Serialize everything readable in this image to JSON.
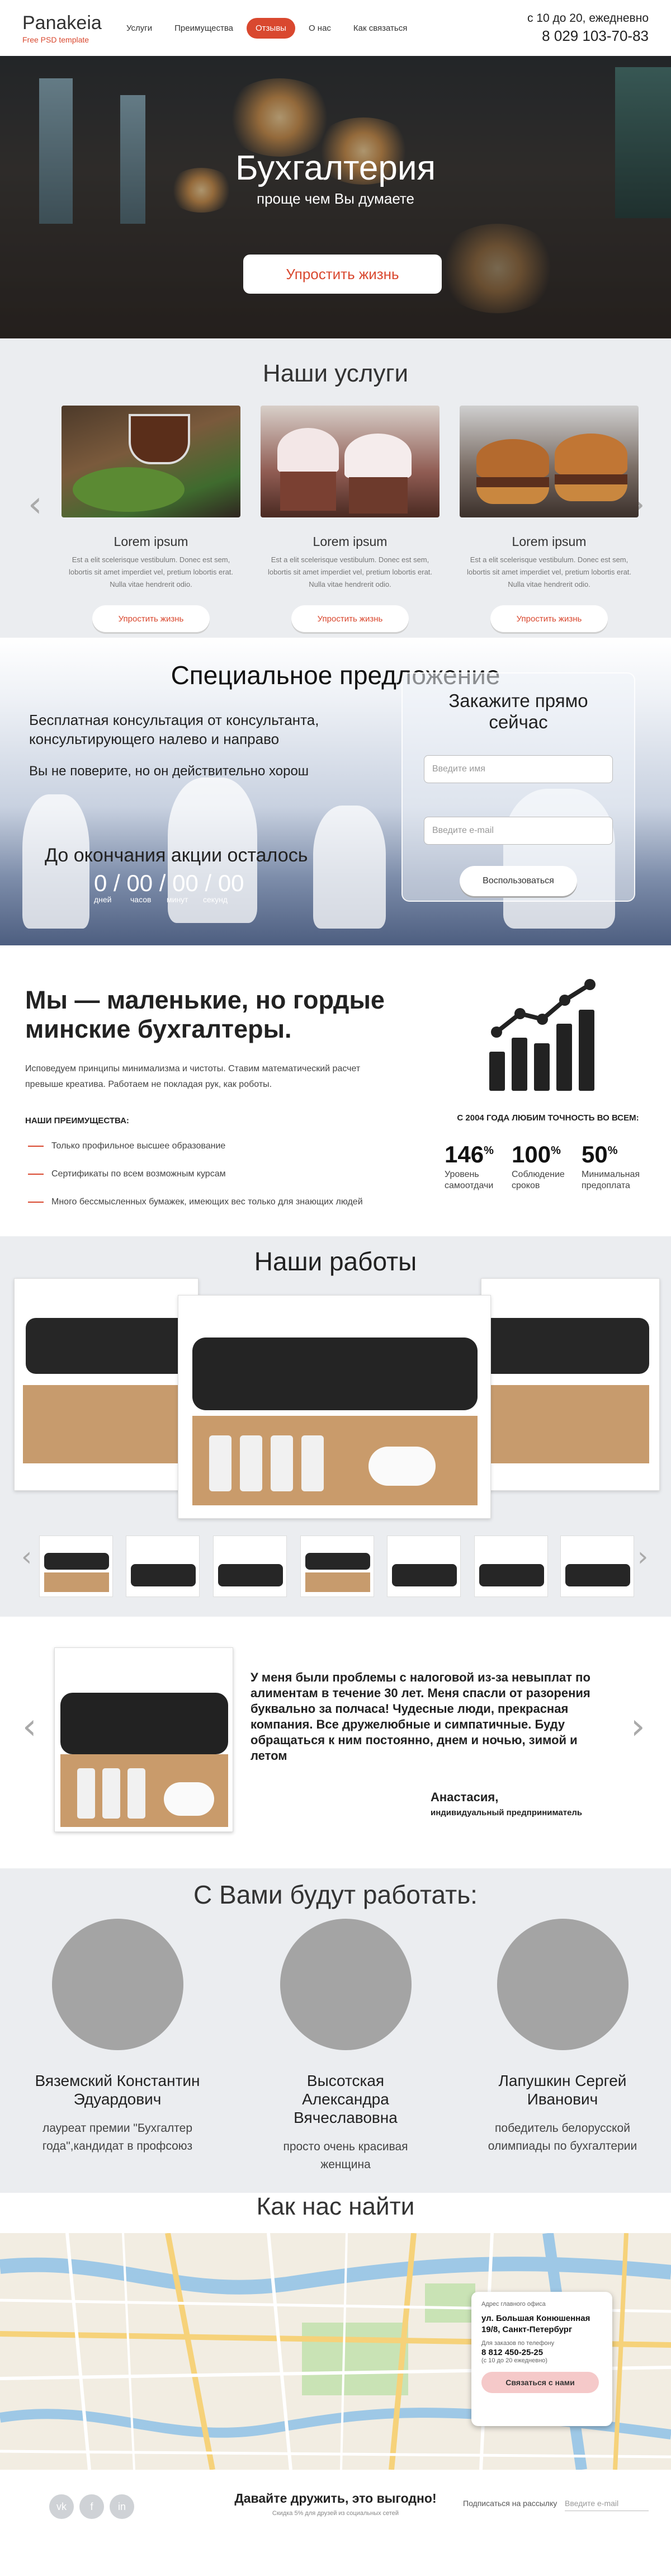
{
  "header": {
    "logo_name": "Panakeia",
    "logo_tag": "Free PSD template",
    "nav": [
      "Услуги",
      "Преимущества",
      "Отзывы",
      "О нас",
      "Как связаться"
    ],
    "active_nav": "Отзывы",
    "hours": "с 10 до 20, ежедневно",
    "phone": "8 029 103-70-83"
  },
  "hero": {
    "title": "Бухгалтерия",
    "subtitle": "проще чем Вы думаете",
    "button": "Упростить жизнь"
  },
  "services": {
    "title": "Наши услуги",
    "items": [
      {
        "title": "Lorem ipsum",
        "text": "Est a elit scelerisque vestibulum. Donec est sem, lobortis sit amet imperdiet vel, pretium lobortis erat. Nulla vitae hendrerit odio.",
        "button": "Упростить жизнь"
      },
      {
        "title": "Lorem ipsum",
        "text": "Est a elit scelerisque vestibulum. Donec est sem, lobortis sit amet imperdiet vel, pretium lobortis erat. Nulla vitae hendrerit odio.",
        "button": "Упростить жизнь"
      },
      {
        "title": "Lorem ipsum",
        "text": "Est a elit scelerisque vestibulum. Donec est sem, lobortis sit amet imperdiet vel, pretium lobortis erat. Nulla vitae hendrerit odio.",
        "button": "Упростить жизнь"
      }
    ]
  },
  "offer": {
    "title": "Специальное предложение",
    "text1": "Бесплатная консультация от консультанта, консультирующего налево и направо",
    "text2": "Вы не поверите, но он действительно хорош",
    "timer_label": "До окончания акции осталось",
    "timer": "0 / 00 / 00 / 00",
    "timer_units": [
      "дней",
      "часов",
      "минут",
      "секунд"
    ],
    "form_title": "Закажите прямо сейчас",
    "name_placeholder": "Введите имя",
    "email_placeholder": "Введите e-mail",
    "form_button": "Воспользоваться"
  },
  "about": {
    "title": "Мы — маленькие, но гордые минские бухгалтеры.",
    "text": "Исповедуем принципы минимализма и чистоты. Ставим математический расчет превыше креатива. Работаем не покладая рук, как роботы.",
    "adv_heading": "НАШИ ПРЕИМУЩЕСТВА:",
    "advantages": [
      "Только профильное высшее образование",
      "Сертификаты по всем возможным курсам",
      "Много бессмысленных бумажек, имеющих вес только для знающих людей"
    ],
    "since": "С 2004 ГОДА ЛЮБИМ ТОЧНОСТЬ ВО ВСЕМ:",
    "stats": [
      {
        "value": "146",
        "unit": "%",
        "label": "Уровень самоотдачи"
      },
      {
        "value": "100",
        "unit": "%",
        "label": "Соблюдение сроков"
      },
      {
        "value": "50",
        "unit": "%",
        "label": "Минимальная предоплата"
      }
    ]
  },
  "works": {
    "title": "Наши работы"
  },
  "testimonial": {
    "text": "У меня были проблемы с налоговой из-за невыплат по алиментам в течение 30 лет. Меня спасли от разорения буквально за полчаса! Чудесные люди, прекрасная компания. Все дружелюбные и симпатичные. Буду обращаться к ним постоянно, днем и ночью, зимой и летом",
    "name": "Анастасия,",
    "role": "индивидуальный предприниматель"
  },
  "team": {
    "title": "С Вами будут работать:",
    "members": [
      {
        "name": "Вяземский Константин Эдуардович",
        "desc": "лауреат премии \"Бухгалтер года\",кандидат в профсоюз"
      },
      {
        "name": "Высотская Александра Вячеславовна",
        "desc": "просто очень красивая женщина"
      },
      {
        "name": "Лапушкин Сергей Иванович",
        "desc": "победитель белорусской олимпиады по бухгалтерии"
      }
    ]
  },
  "map": {
    "title": "Как нас найти",
    "office_label": "Адрес главного офиса",
    "address": "ул. Большая Конюшенная 19/8, Санкт-Петербург",
    "phone_label": "Для заказов по телефону",
    "phone": "8 812 450-25-25",
    "hours": "(с 10 до 20 ежедневно)",
    "button": "Связаться с нами"
  },
  "footer": {
    "social": [
      "vk",
      "f",
      "in"
    ],
    "main": "Давайте дружить, это выгодно!",
    "sub": "Скидка 5% для друзей из социальных сетей",
    "subscribe": "Подписаться на рассылку",
    "email_placeholder": "Введите e-mail"
  },
  "colors": {
    "accent": "#d9482f",
    "section_gray": "#ebedf0",
    "avatar_gray": "#a4a4a4"
  }
}
